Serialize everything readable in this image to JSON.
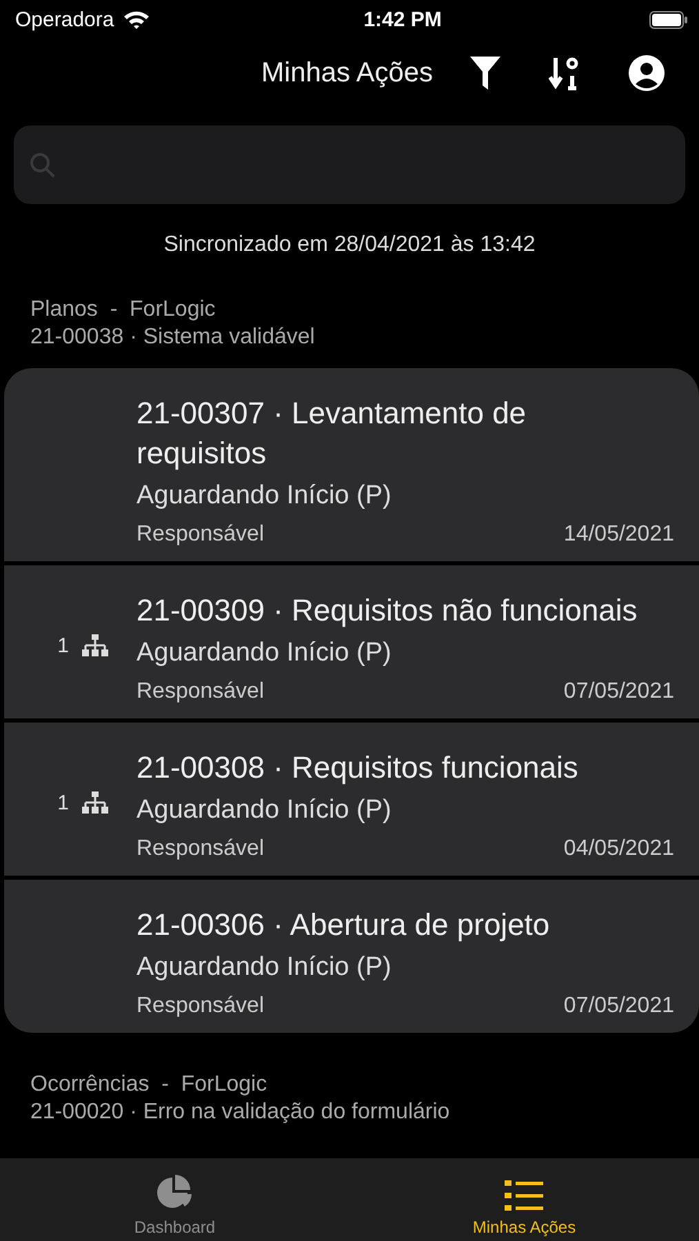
{
  "status_bar": {
    "carrier": "Operadora",
    "time": "1:42 PM"
  },
  "header": {
    "title": "Minhas Ações"
  },
  "sync_text": "Sincronizado em 28/04/2021 às 13:42",
  "groups": [
    {
      "category": "Planos  -  ForLogic",
      "subtitle": "21-00038 · Sistema validável",
      "actions": [
        {
          "title": "21-00307 · Levantamento de requisitos",
          "status": "Aguardando Início (P)",
          "role": "Responsável",
          "date": "14/05/2021"
        },
        {
          "title": "21-00309 · Requisitos não funcionais",
          "status": "Aguardando Início (P)",
          "role": "Responsável",
          "date": "07/05/2021",
          "sub_count": "1"
        },
        {
          "title": "21-00308 · Requisitos funcionais",
          "status": "Aguardando Início (P)",
          "role": "Responsável",
          "date": "04/05/2021",
          "sub_count": "1"
        },
        {
          "title": "21-00306 · Abertura de projeto",
          "status": "Aguardando Início (P)",
          "role": "Responsável",
          "date": "07/05/2021"
        }
      ]
    },
    {
      "category": "Ocorrências  -  ForLogic",
      "subtitle": "21-00020 · Erro na validação do formulário"
    }
  ],
  "tab_bar": [
    {
      "kind": "dashboard",
      "label": "Dashboard",
      "selected": false
    },
    {
      "kind": "list",
      "label": "Minhas Ações",
      "selected": true
    }
  ]
}
